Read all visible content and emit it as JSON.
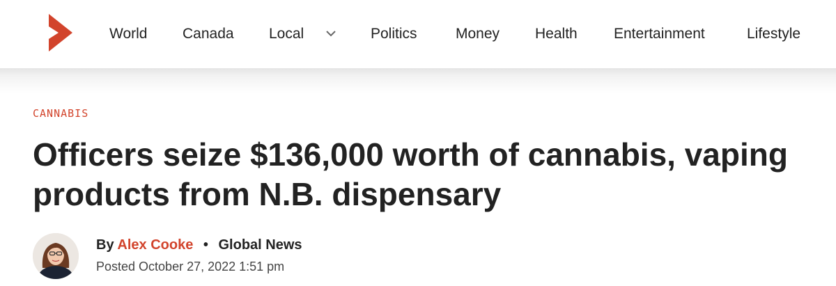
{
  "brand": {
    "accent_color": "#d2442c",
    "logo_icon": "chevron-logo-icon"
  },
  "nav": {
    "items": [
      {
        "label": "World"
      },
      {
        "label": "Canada"
      },
      {
        "label": "Local",
        "has_dropdown": true
      },
      {
        "label": "Politics"
      },
      {
        "label": "Money"
      },
      {
        "label": "Health"
      },
      {
        "label": "Entertainment"
      },
      {
        "label": "Lifestyle"
      }
    ]
  },
  "article": {
    "category": "CANNABIS",
    "headline": "Officers seize $136,000 worth of cannabis, vaping products from N.B. dispensary",
    "byline": {
      "prefix": "By",
      "author": "Alex Cooke",
      "separator": "•",
      "outlet": "Global News"
    },
    "posted": "Posted October 27, 2022 1:51 pm"
  }
}
